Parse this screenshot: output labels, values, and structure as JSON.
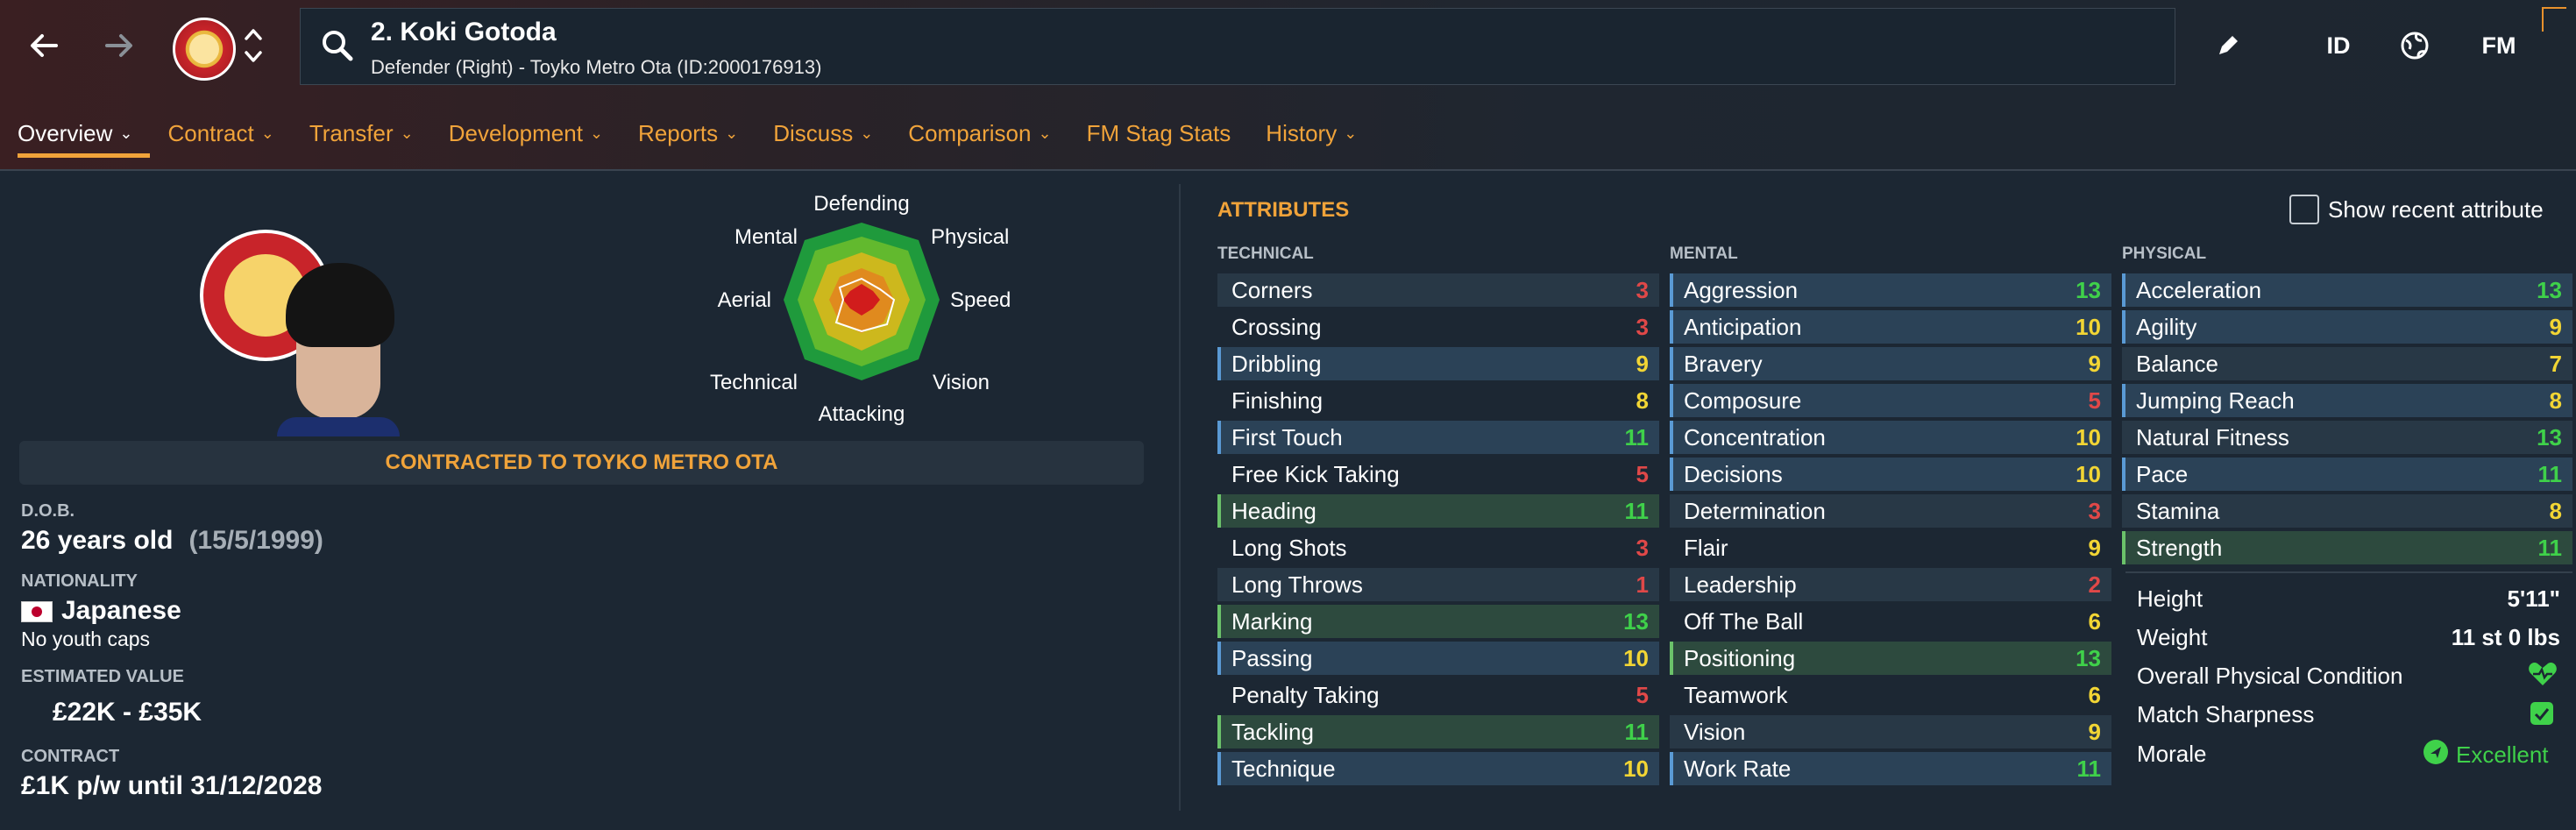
{
  "header": {
    "player_title": "2. Koki Gotoda",
    "player_subtitle": "Defender (Right) - Toyko Metro Ota (ID:2000176913)",
    "icons": [
      "back-arrow-icon",
      "forward-arrow-icon",
      "club-badge-icon",
      "up-down-icon",
      "search-icon",
      "edit-icon",
      "id-icon",
      "globe-icon",
      "fm-icon"
    ],
    "id_label": "ID",
    "fm_label": "FM"
  },
  "tabs": [
    {
      "label": "Overview",
      "active": true
    },
    {
      "label": "Contract"
    },
    {
      "label": "Transfer"
    },
    {
      "label": "Development"
    },
    {
      "label": "Reports"
    },
    {
      "label": "Discuss"
    },
    {
      "label": "Comparison"
    },
    {
      "label": "FM Stag Stats"
    },
    {
      "label": "History"
    }
  ],
  "radar": {
    "labels": {
      "top": "Defending",
      "top_right": "Physical",
      "right": "Speed",
      "bottom_right": "Vision",
      "bottom": "Attacking",
      "bottom_left": "Technical",
      "left": "Aerial",
      "top_left": "Mental"
    }
  },
  "contract_status": "CONTRACTED TO TOYKO METRO OTA",
  "info": {
    "dob_label": "D.O.B.",
    "dob_age": "26 years old",
    "dob_date": "(15/5/1999)",
    "nationality_label": "NATIONALITY",
    "nationality": "Japanese",
    "youth_caps": "No youth caps",
    "value_label": "ESTIMATED VALUE",
    "value": "£22K - £35K",
    "contract_label": "CONTRACT",
    "contract": "£1K p/w until 31/12/2028"
  },
  "attributes": {
    "title": "ATTRIBUTES",
    "show_recent": "Show recent attribute",
    "technical_label": "TECHNICAL",
    "mental_label": "MENTAL",
    "physical_label": "PHYSICAL",
    "technical": [
      {
        "name": "Corners",
        "value": "3"
      },
      {
        "name": "Crossing",
        "value": "3"
      },
      {
        "name": "Dribbling",
        "value": "9"
      },
      {
        "name": "Finishing",
        "value": "8"
      },
      {
        "name": "First Touch",
        "value": "11"
      },
      {
        "name": "Free Kick Taking",
        "value": "5"
      },
      {
        "name": "Heading",
        "value": "11"
      },
      {
        "name": "Long Shots",
        "value": "3"
      },
      {
        "name": "Long Throws",
        "value": "1"
      },
      {
        "name": "Marking",
        "value": "13"
      },
      {
        "name": "Passing",
        "value": "10"
      },
      {
        "name": "Penalty Taking",
        "value": "5"
      },
      {
        "name": "Tackling",
        "value": "11"
      },
      {
        "name": "Technique",
        "value": "10"
      }
    ],
    "mental": [
      {
        "name": "Aggression",
        "value": "13"
      },
      {
        "name": "Anticipation",
        "value": "10"
      },
      {
        "name": "Bravery",
        "value": "9"
      },
      {
        "name": "Composure",
        "value": "5"
      },
      {
        "name": "Concentration",
        "value": "10"
      },
      {
        "name": "Decisions",
        "value": "10"
      },
      {
        "name": "Determination",
        "value": "3"
      },
      {
        "name": "Flair",
        "value": "9"
      },
      {
        "name": "Leadership",
        "value": "2"
      },
      {
        "name": "Off The Ball",
        "value": "6"
      },
      {
        "name": "Positioning",
        "value": "13"
      },
      {
        "name": "Teamwork",
        "value": "6"
      },
      {
        "name": "Vision",
        "value": "9"
      },
      {
        "name": "Work Rate",
        "value": "11"
      }
    ],
    "physical": [
      {
        "name": "Acceleration",
        "value": "13"
      },
      {
        "name": "Agility",
        "value": "9"
      },
      {
        "name": "Balance",
        "value": "7"
      },
      {
        "name": "Jumping Reach",
        "value": "8"
      },
      {
        "name": "Natural Fitness",
        "value": "13"
      },
      {
        "name": "Pace",
        "value": "11"
      },
      {
        "name": "Stamina",
        "value": "8"
      },
      {
        "name": "Strength",
        "value": "11"
      }
    ],
    "physical_info": {
      "height_label": "Height",
      "height": "5'11\"",
      "weight_label": "Weight",
      "weight": "11 st 0 lbs",
      "condition_label": "Overall Physical Condition",
      "sharpness_label": "Match Sharpness",
      "morale_label": "Morale",
      "morale": "Excellent"
    }
  },
  "colors": {
    "accent": "#f0a33a",
    "value_low": "#e04848",
    "value_mid": "#f2d534",
    "value_high": "#3fd14a"
  }
}
